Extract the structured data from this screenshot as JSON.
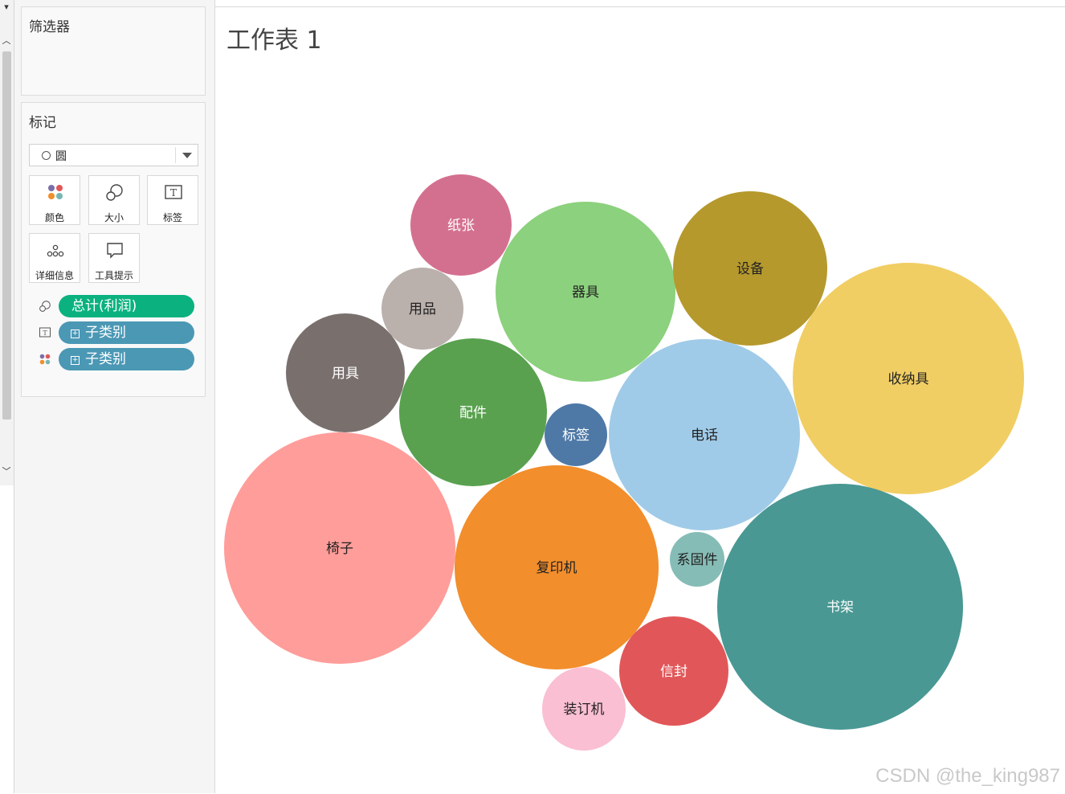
{
  "filters_panel": {
    "title": "筛选器"
  },
  "marks_panel": {
    "title": "标记",
    "mark_type": "圆",
    "buttons": [
      {
        "label": "颜色",
        "icon": "color-dots-icon"
      },
      {
        "label": "大小",
        "icon": "size-circles-icon"
      },
      {
        "label": "标签",
        "icon": "label-text-icon"
      },
      {
        "label": "详细信息",
        "icon": "detail-dots-icon"
      },
      {
        "label": "工具提示",
        "icon": "tooltip-bubble-icon"
      }
    ],
    "pills": [
      {
        "label": "总计(利润)",
        "role": "size",
        "icon": "size-circles-icon",
        "color": "#0bb27f",
        "expandable": false
      },
      {
        "label": "子类别",
        "role": "label",
        "icon": "label-text-icon",
        "color": "#4b98b5",
        "expandable": true
      },
      {
        "label": "子类别",
        "role": "color",
        "icon": "color-dots-icon",
        "color": "#4b98b5",
        "expandable": true
      }
    ]
  },
  "sheet": {
    "title": "工作表 1"
  },
  "chart_data": {
    "type": "bubble",
    "size_measure": "总计(利润)",
    "label_dimension": "子类别",
    "bubbles": [
      {
        "label": "纸张",
        "color": "#d4708f",
        "text_color": "#ffffff"
      },
      {
        "label": "器具",
        "color": "#8cd17d",
        "text_color": "#222222"
      },
      {
        "label": "设备",
        "color": "#b6992d",
        "text_color": "#222222"
      },
      {
        "label": "用品",
        "color": "#bab0ac",
        "text_color": "#222222"
      },
      {
        "label": "收纳具",
        "color": "#f1ce63",
        "text_color": "#222222"
      },
      {
        "label": "用具",
        "color": "#79706e",
        "text_color": "#ffffff"
      },
      {
        "label": "配件",
        "color": "#59a14f",
        "text_color": "#ffffff"
      },
      {
        "label": "标签",
        "color": "#4e79a7",
        "text_color": "#ffffff"
      },
      {
        "label": "电话",
        "color": "#a0cbe8",
        "text_color": "#222222"
      },
      {
        "label": "椅子",
        "color": "#ff9d9a",
        "text_color": "#222222"
      },
      {
        "label": "复印机",
        "color": "#f28e2b",
        "text_color": "#222222"
      },
      {
        "label": "系固件",
        "color": "#86bcb6",
        "text_color": "#222222"
      },
      {
        "label": "书架",
        "color": "#499894",
        "text_color": "#ffffff"
      },
      {
        "label": "信封",
        "color": "#e15759",
        "text_color": "#ffffff"
      },
      {
        "label": "装订机",
        "color": "#fabfd2",
        "text_color": "#222222"
      }
    ]
  },
  "watermark": "CSDN @the_king987"
}
